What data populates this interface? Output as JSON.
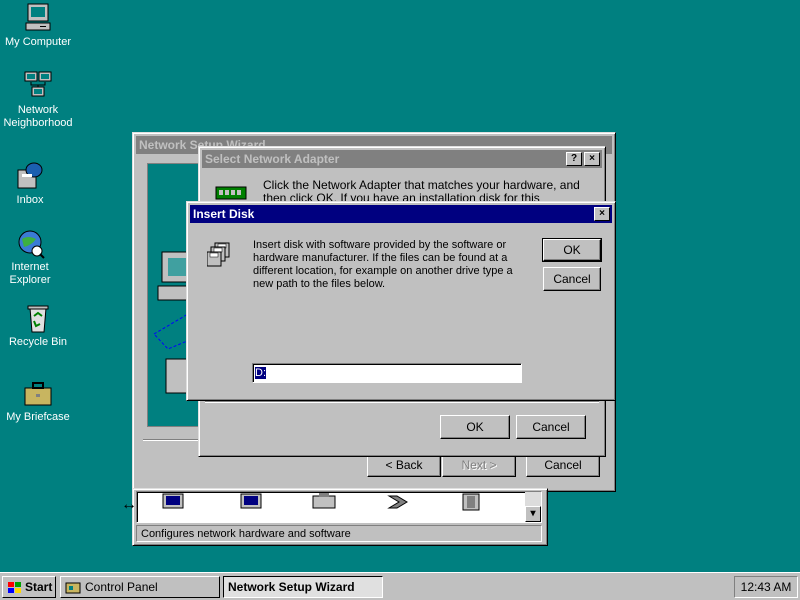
{
  "desktop": {
    "icons": [
      {
        "label": "My Computer"
      },
      {
        "label_line1": "Network",
        "label_line2": "Neighborhood"
      },
      {
        "label": "Inbox"
      },
      {
        "label_line1": "Internet",
        "label_line2": "Explorer"
      },
      {
        "label": "Recycle Bin"
      },
      {
        "label": "My Briefcase"
      }
    ]
  },
  "wizard": {
    "title": "Network Setup Wizard",
    "back_label": "< Back",
    "next_label": "Next >",
    "cancel_label": "Cancel"
  },
  "control_panel": {
    "status": "Configures network hardware and software"
  },
  "select_adapter": {
    "title": "Select Network Adapter",
    "help_btn": "?",
    "close_btn": "×",
    "instruction": "Click the Network Adapter that matches your hardware, and then click OK.  If you have an installation disk for this component, click",
    "ok_label": "OK",
    "cancel_label": "Cancel"
  },
  "insert_disk": {
    "title": "Insert Disk",
    "close_btn": "×",
    "message": "Insert disk with software provided by the software or hardware manufacturer.  If the files can be found at a different location, for example on another drive type a new path to the files below.",
    "path_value": "D:",
    "ok_label": "OK",
    "cancel_label": "Cancel"
  },
  "taskbar": {
    "start_label": "Start",
    "tasks": [
      {
        "label": "Control Panel"
      },
      {
        "label": "Network Setup Wizard"
      }
    ],
    "clock": "12:43 AM"
  }
}
